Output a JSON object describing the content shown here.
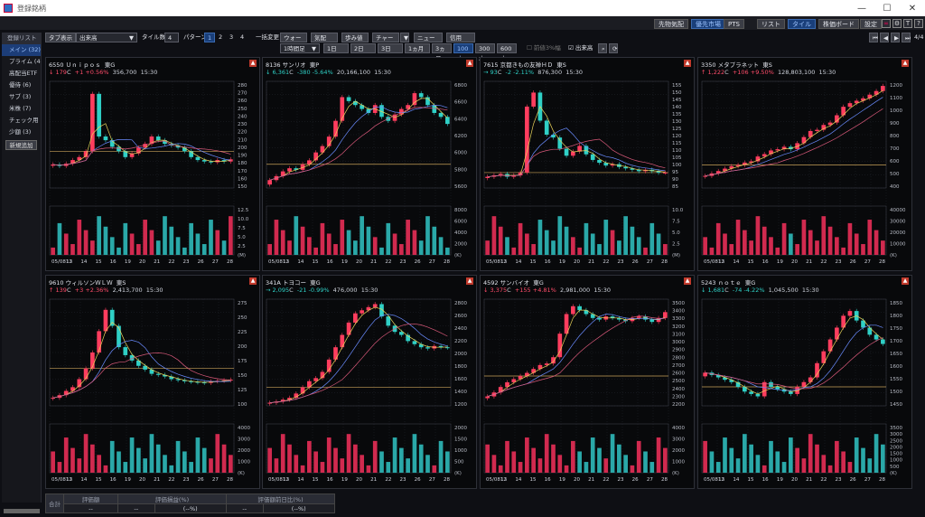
{
  "window": {
    "title": "登録銘柄"
  },
  "toolbar1": {
    "buttons": [
      "先物気配",
      "優先市場",
      "PTS",
      "リスト",
      "タイル",
      "株価ボード",
      "設定"
    ]
  },
  "sidebar": {
    "header": "登録リスト",
    "items": [
      "メイン (32)",
      "プライム (4)",
      "高配当ETF",
      "優待 (6)",
      "サブ (3)",
      "米株 (7)",
      "チェック用 (",
      "少額 (3)"
    ],
    "add_label": "新規追加"
  },
  "toolbar2": {
    "tab_label": "タブ表示",
    "tab_value": "出来高",
    "tile_count_label": "タイル数",
    "tile_count_value": "4",
    "pattern_label": "パターン",
    "patterns": [
      "1",
      "2",
      "3",
      "4"
    ],
    "change_label": "一括変更",
    "buttons": [
      "ウォート",
      "気配",
      "歩み値",
      "チャート",
      "ニュース",
      "信用"
    ],
    "page": "4/4"
  },
  "toolbar3": {
    "interval": "1時間足",
    "ranges": [
      "1日",
      "2日",
      "3日",
      "1ヵ月",
      "3ヵ月",
      "100本",
      "300本",
      "600本"
    ],
    "active_range": "100本",
    "option1": "前値3%幅",
    "option2": "出来高"
  },
  "colors": {
    "up": "#ff3d5e",
    "down": "#2fd0c6",
    "bg": "#08090b"
  },
  "xdates": [
    "05/0812",
    "13",
    "14",
    "15",
    "16",
    "19",
    "20",
    "21",
    "22",
    "23",
    "26",
    "27",
    "28"
  ],
  "panels": [
    {
      "code": "6550",
      "name": "Ｕｎｉｐｏｓ",
      "market": "東G",
      "dir": "↓",
      "price": "179",
      "mark": "C",
      "change": "+1",
      "pct": "+0.56%",
      "volume": "356,700",
      "time": "15:30",
      "trend": "up",
      "price_ticks": [
        "280",
        "270",
        "260",
        "250",
        "240",
        "230",
        "220",
        "210",
        "200",
        "190",
        "180",
        "170",
        "160",
        "150"
      ],
      "vol_ticks": [
        "12.5",
        "10.0",
        "7.5",
        "5.0",
        "2.5",
        "(M)"
      ],
      "chart_data": {
        "type": "candlestick",
        "close": [
          172,
          170,
          173,
          178,
          182,
          190,
          268,
          210,
          205,
          196,
          190,
          182,
          187,
          195,
          200,
          210,
          205,
          200,
          198,
          195,
          190,
          182,
          178,
          176,
          175,
          178,
          176,
          179
        ],
        "ylim": [
          140,
          285
        ]
      }
    },
    {
      "code": "8136",
      "name": "サンリオ",
      "market": "東P",
      "dir": "↓",
      "price": "6,361",
      "mark": "C",
      "change": "-380",
      "pct": "-5.64%",
      "volume": "20,166,100",
      "time": "15:30",
      "trend": "dn",
      "price_ticks": [
        "6800",
        "6600",
        "6400",
        "6200",
        "6000",
        "5800",
        "5600"
      ],
      "vol_ticks": [
        "8000",
        "6000",
        "4000",
        "2000",
        "(K)"
      ],
      "chart_data": {
        "type": "candlestick",
        "close": [
          5650,
          5700,
          5760,
          5800,
          5780,
          5850,
          5900,
          6000,
          6080,
          6200,
          6400,
          6700,
          6650,
          6600,
          6550,
          6500,
          6600,
          6450,
          6400,
          6480,
          6550,
          6600,
          6750,
          6700,
          6600,
          6500,
          6450,
          6361
        ],
        "ylim": [
          5550,
          6900
        ]
      }
    },
    {
      "code": "7615",
      "name": "京都きもの友禅ＨＤ",
      "market": "東S",
      "dir": "→",
      "price": "93",
      "mark": "C",
      "change": "-2",
      "pct": "-2.11%",
      "volume": "876,300",
      "time": "15:30",
      "trend": "dn",
      "price_ticks": [
        "155",
        "150",
        "145",
        "140",
        "135",
        "130",
        "125",
        "120",
        "115",
        "110",
        "105",
        "100",
        "95",
        "90",
        "85"
      ],
      "vol_ticks": [
        "10.0",
        "7.5",
        "5.0",
        "2.5",
        "(M)"
      ],
      "chart_data": {
        "type": "candlestick",
        "close": [
          90,
          91,
          92,
          90,
          91,
          93,
          140,
          150,
          130,
          120,
          118,
          110,
          105,
          108,
          112,
          106,
          102,
          100,
          98,
          99,
          97,
          96,
          95,
          94,
          95,
          94,
          93,
          93
        ],
        "ylim": [
          82,
          158
        ]
      }
    },
    {
      "code": "3350",
      "name": "メタプラネット",
      "market": "東S",
      "dir": "↑",
      "price": "1,222",
      "mark": "C",
      "change": "+106",
      "pct": "+9.50%",
      "volume": "128,803,100",
      "time": "15:30",
      "trend": "up",
      "price_ticks": [
        "1200",
        "1100",
        "1000",
        "900",
        "800",
        "700",
        "600",
        "500",
        "400"
      ],
      "vol_ticks": [
        "40000",
        "30000",
        "20000",
        "10000",
        "(K)"
      ],
      "chart_data": {
        "type": "candlestick",
        "close": [
          480,
          500,
          520,
          540,
          560,
          570,
          590,
          600,
          640,
          660,
          690,
          700,
          720,
          700,
          750,
          800,
          850,
          860,
          900,
          920,
          980,
          1050,
          1080,
          1100,
          1120,
          1150,
          1180,
          1222
        ],
        "ylim": [
          380,
          1260
        ]
      }
    },
    {
      "code": "9610",
      "name": "ウィルソンＷＬＷ",
      "market": "東S",
      "dir": "↑",
      "price": "139",
      "mark": "C",
      "change": "+3",
      "pct": "+2.36%",
      "volume": "2,413,700",
      "time": "15:30",
      "trend": "up",
      "price_ticks": [
        "275",
        "250",
        "225",
        "200",
        "175",
        "150",
        "125",
        "100"
      ],
      "vol_ticks": [
        "4000",
        "3000",
        "2000",
        "1000",
        "(K)"
      ],
      "chart_data": {
        "type": "candlestick",
        "close": [
          105,
          110,
          118,
          125,
          140,
          160,
          190,
          230,
          270,
          240,
          200,
          185,
          175,
          165,
          158,
          150,
          148,
          145,
          140,
          138,
          136,
          135,
          134,
          133,
          136,
          137,
          138,
          139
        ],
        "ylim": [
          90,
          290
        ]
      }
    },
    {
      "code": "341A",
      "name": "トヨコー",
      "market": "東G",
      "dir": "→",
      "price": "2,095",
      "mark": "C",
      "change": "-21",
      "pct": "-0.99%",
      "volume": "476,000",
      "time": "15:30",
      "trend": "dn",
      "price_ticks": [
        "2800",
        "2600",
        "2400",
        "2200",
        "2000",
        "1800",
        "1600",
        "1400",
        "1200"
      ],
      "vol_ticks": [
        "2000",
        "1500",
        "1000",
        "500",
        "(K)"
      ],
      "chart_data": {
        "type": "candlestick",
        "close": [
          1200,
          1220,
          1250,
          1280,
          1350,
          1450,
          1550,
          1600,
          1700,
          1900,
          2100,
          2300,
          2500,
          2650,
          2700,
          2750,
          2800,
          2600,
          2450,
          2350,
          2300,
          2200,
          2150,
          2100,
          2080,
          2120,
          2100,
          2095
        ],
        "ylim": [
          1150,
          2880
        ]
      }
    },
    {
      "code": "4592",
      "name": "サンバイオ",
      "market": "東G",
      "dir": "↓",
      "price": "3,375",
      "mark": "C",
      "change": "+155",
      "pct": "+4.81%",
      "volume": "2,981,000",
      "time": "15:30",
      "trend": "up",
      "price_ticks": [
        "3500",
        "3400",
        "3300",
        "3200",
        "3100",
        "3000",
        "2900",
        "2800",
        "2700",
        "2600",
        "2500",
        "2400",
        "2300",
        "2200"
      ],
      "vol_ticks": [
        "4000",
        "3000",
        "2000",
        "1000",
        "(K)"
      ],
      "chart_data": {
        "type": "candlestick",
        "close": [
          2300,
          2350,
          2420,
          2480,
          2520,
          2560,
          2600,
          2650,
          2700,
          2720,
          2800,
          3100,
          3350,
          3450,
          3400,
          3350,
          3300,
          3280,
          3320,
          3300,
          3280,
          3260,
          3300,
          3320,
          3280,
          3250,
          3300,
          3375
        ],
        "ylim": [
          2180,
          3540
        ]
      }
    },
    {
      "code": "5243",
      "name": "ｎｏｔｅ",
      "market": "東G",
      "dir": "↓",
      "price": "1,681",
      "mark": "C",
      "change": "-74",
      "pct": "-4.22%",
      "volume": "1,045,500",
      "time": "15:30",
      "trend": "dn",
      "price_ticks": [
        "1850",
        "1800",
        "1750",
        "1700",
        "1650",
        "1600",
        "1550",
        "1500",
        "1450"
      ],
      "vol_ticks": [
        "3500",
        "3000",
        "2500",
        "2000",
        "1500",
        "1000",
        "500",
        "(K)"
      ],
      "chart_data": {
        "type": "candlestick",
        "close": [
          1560,
          1550,
          1540,
          1530,
          1520,
          1500,
          1480,
          1470,
          1460,
          1520,
          1500,
          1490,
          1480,
          1470,
          1500,
          1520,
          1540,
          1600,
          1650,
          1700,
          1750,
          1800,
          1820,
          1780,
          1750,
          1720,
          1700,
          1681
        ],
        "ylim": [
          1420,
          1870
        ]
      }
    }
  ],
  "summary": {
    "headers": [
      "合計",
      "評価額",
      "評価損益(%)",
      "評価額前日比(%)"
    ],
    "values": [
      "--",
      "--",
      "(--%)",
      "--",
      "(--%)"
    ]
  }
}
